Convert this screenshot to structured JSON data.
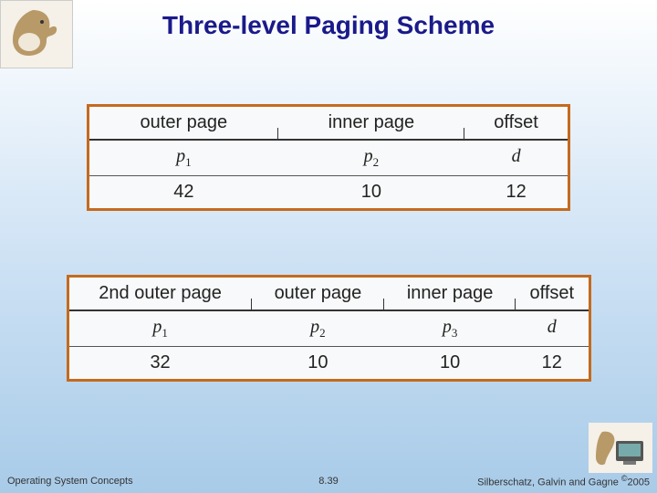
{
  "title": "Three-level Paging Scheme",
  "table1": {
    "headers": [
      "outer page",
      "inner page",
      "offset"
    ],
    "symbols": [
      {
        "base": "p",
        "sub": "1"
      },
      {
        "base": "p",
        "sub": "2"
      },
      {
        "base": "d",
        "sub": ""
      }
    ],
    "values": [
      "42",
      "10",
      "12"
    ]
  },
  "table2": {
    "headers": [
      "2nd outer page",
      "outer page",
      "inner page",
      "offset"
    ],
    "symbols": [
      {
        "base": "p",
        "sub": "1"
      },
      {
        "base": "p",
        "sub": "2"
      },
      {
        "base": "p",
        "sub": "3"
      },
      {
        "base": "d",
        "sub": ""
      }
    ],
    "values": [
      "32",
      "10",
      "10",
      "12"
    ]
  },
  "footer": {
    "left": "Operating System Concepts",
    "center": "8.39",
    "right_prefix": "Silberschatz, Galvin and Gagne ",
    "right_copy": "©",
    "right_year": "2005"
  }
}
